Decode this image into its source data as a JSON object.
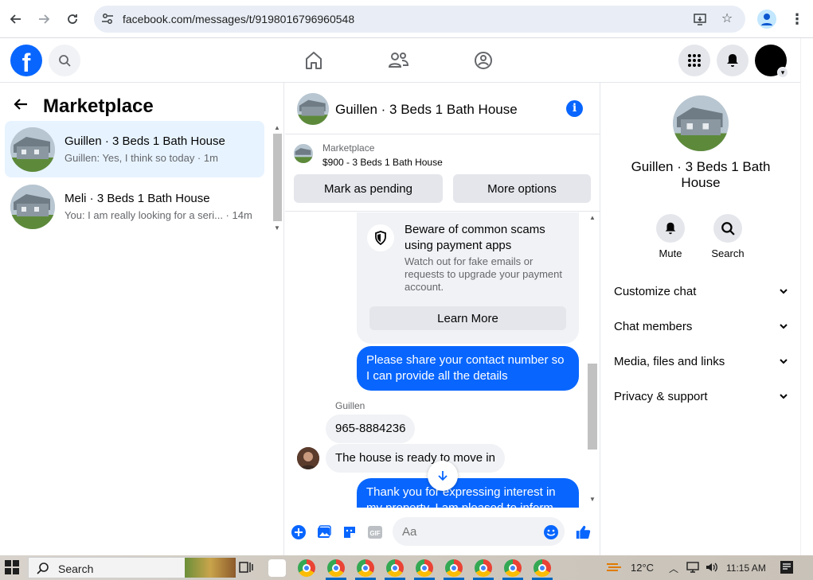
{
  "browser": {
    "url": "facebook.com/messages/t/9198016796960548",
    "back_icon": "arrow-left",
    "forward_icon": "arrow-right",
    "reload_icon": "reload"
  },
  "fb": {
    "logo": "f"
  },
  "left": {
    "title": "Marketplace",
    "conversations": [
      {
        "name": "Guillen · 3 Beds 1 Bath House",
        "snippet": "Guillen: Yes, I think so today · 1m",
        "active": true
      },
      {
        "name": "Meli · 3 Beds 1 Bath House",
        "snippet": "You: I am really looking for a seri... · 14m",
        "active": false
      }
    ]
  },
  "chat": {
    "title": "Guillen · 3 Beds 1 Bath House",
    "marketplace_label": "Marketplace",
    "listing": "$900 - 3 Beds 1 Bath House",
    "mark_pending": "Mark as pending",
    "more_options": "More options",
    "scam_title": "Beware of common scams using payment apps",
    "scam_body": "Watch out for fake emails or requests to upgrade your payment account.",
    "learn_more": "Learn More",
    "messages": [
      {
        "text": "Please share your contact number so I can provide all the details",
        "dir": "out"
      },
      {
        "sender": "Guillen"
      },
      {
        "text": "965-8884236",
        "dir": "in"
      },
      {
        "text": "The house is ready to move in",
        "dir": "in"
      },
      {
        "text": "Thank you for expressing interest in my property. I am pleased to inform",
        "dir": "out"
      }
    ],
    "input_placeholder": "Aa"
  },
  "right": {
    "name": "Guillen · 3 Beds 1 Bath House",
    "mute": "Mute",
    "search": "Search",
    "rows": [
      "Customize chat",
      "Chat members",
      "Media, files and links",
      "Privacy & support"
    ]
  },
  "taskbar": {
    "search": "Search",
    "temp": "12°C",
    "time": "11:15 AM"
  },
  "colors": {
    "brand": "#0866ff",
    "active_bg": "#e7f3ff",
    "bubble_in": "#f0f2f5"
  }
}
